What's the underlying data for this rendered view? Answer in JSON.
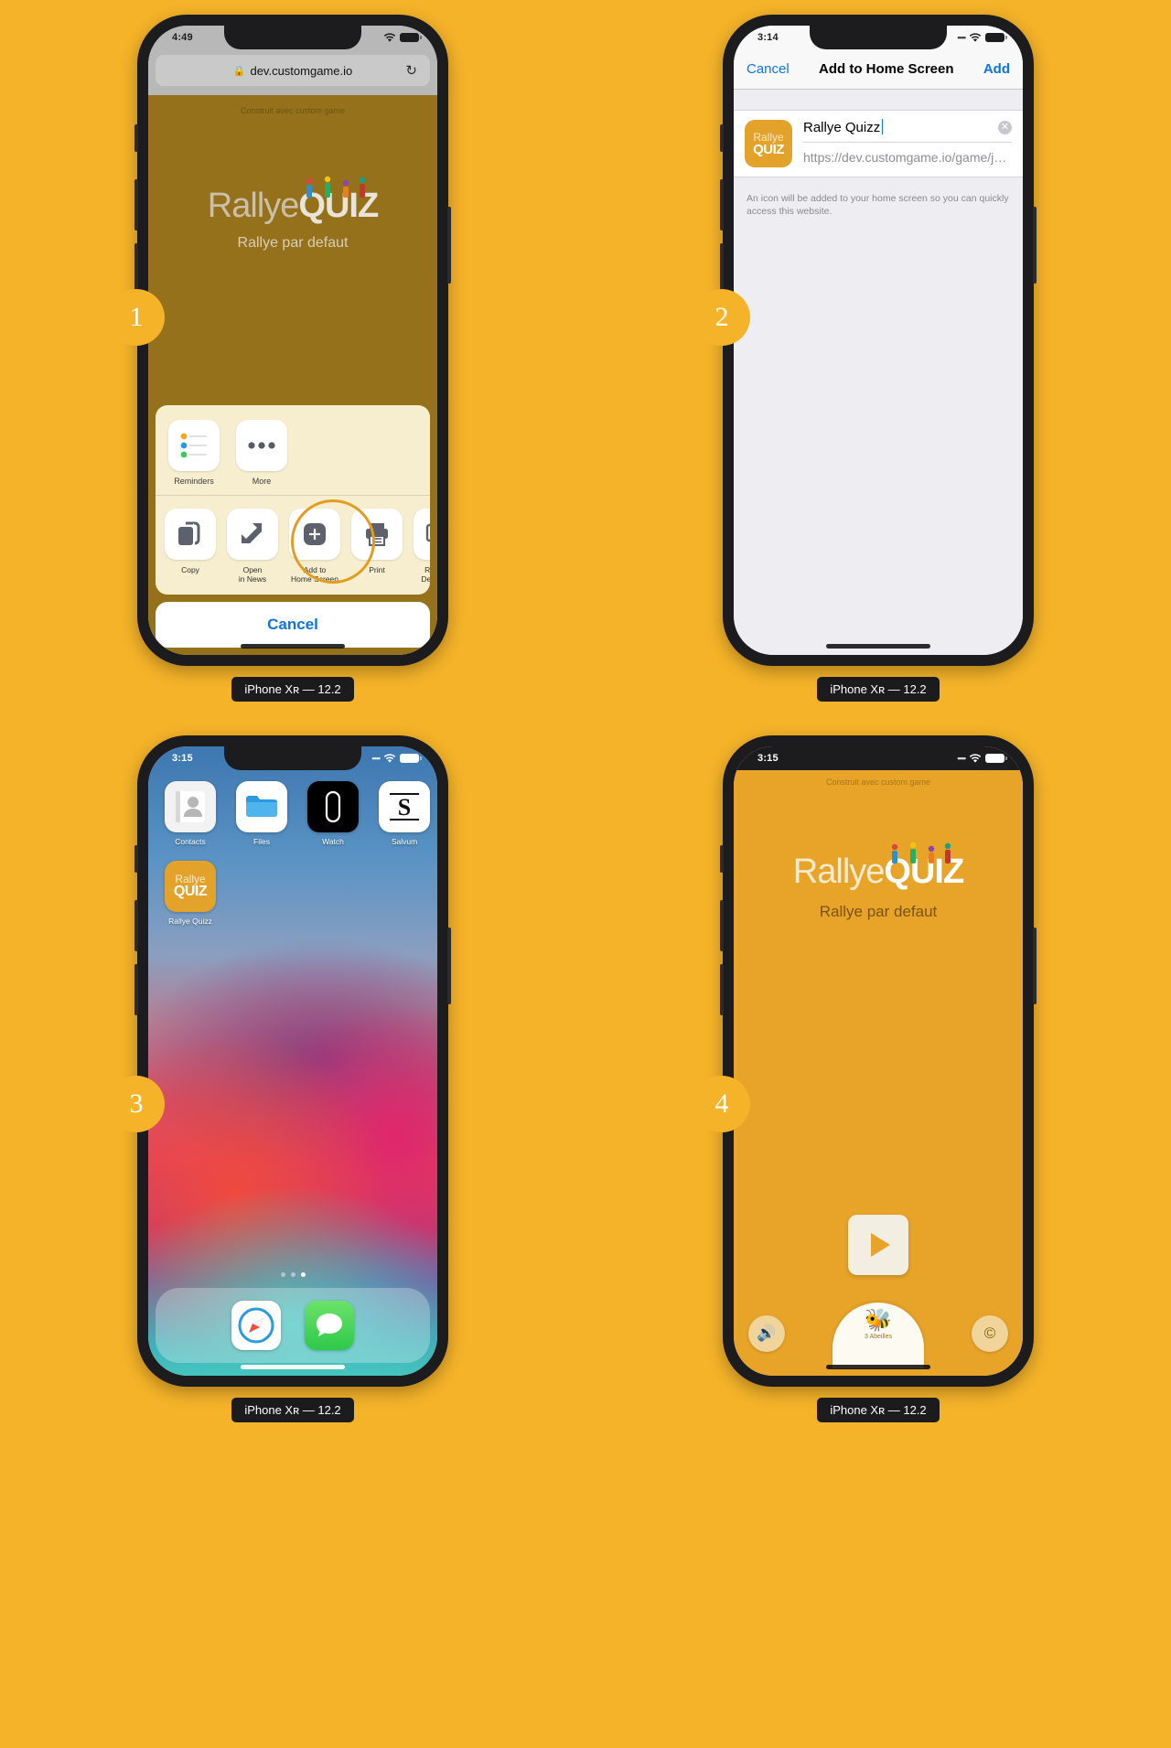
{
  "page": {
    "background_color": "#f5b329",
    "badge_color": "#f5b329",
    "caption_device": "iPhone X",
    "caption_device_sub": "R",
    "caption_version": " — 12.2"
  },
  "panels": [
    {
      "badge": "1",
      "caption": "iPhone Xʀ — 12.2",
      "status": {
        "time": "4:49",
        "dots": "",
        "wifi": "wifi-icon",
        "battery": "battery-icon"
      },
      "safari": {
        "url": "dev.customgame.io",
        "lock_icon": "lock-icon",
        "reload_icon": "reload-icon"
      },
      "page": {
        "built_with": "Construit avec custom game",
        "logo_part1": "Rallye",
        "logo_part2": "QUIZ",
        "subtitle": "Rallye par defaut"
      },
      "share_sheet": {
        "apps": [
          {
            "label": "Reminders",
            "icon": "reminders-icon"
          },
          {
            "label": "More",
            "icon": "more-icon"
          }
        ],
        "actions": [
          {
            "label": "Copy",
            "icon": "copy-icon",
            "highlighted": false
          },
          {
            "label": "Open\nin News",
            "icon": "news-icon",
            "highlighted": false
          },
          {
            "label": "Add to\nHome Screen",
            "icon": "add-to-home-screen-icon",
            "highlighted": true
          },
          {
            "label": "Print",
            "icon": "printer-icon",
            "highlighted": false
          },
          {
            "label": "Request\nDesktop S",
            "icon": "desktop-icon",
            "highlighted": false
          }
        ],
        "cancel_label": "Cancel",
        "highlight_color": "#e39c22"
      }
    },
    {
      "badge": "2",
      "caption": "iPhone Xʀ — 12.2",
      "status": {
        "time": "3:14"
      },
      "nav": {
        "cancel_label": "Cancel",
        "title": "Add to Home Screen",
        "add_label": "Add"
      },
      "form": {
        "icon_line1": "Rallye",
        "icon_line2": "QUIZ",
        "name_value": "Rallye Quizz",
        "clear_icon": "clear-icon",
        "url_value": "https://dev.customgame.io/game/jeu-...",
        "note": "An icon will be added to your home screen so you can quickly access this website."
      }
    },
    {
      "badge": "3",
      "caption": "iPhone Xʀ — 12.2",
      "status": {
        "time": "3:15"
      },
      "home": {
        "rows": [
          [
            {
              "label": "Contacts",
              "icon": "contacts-icon"
            },
            {
              "label": "Files",
              "icon": "files-icon"
            },
            {
              "label": "Watch",
              "icon": "watch-icon"
            },
            {
              "label": "Salvum",
              "icon": "salvum-icon"
            }
          ],
          [
            {
              "label": "Rallye Quizz",
              "icon": "rallye-quizz-icon"
            }
          ]
        ],
        "page_dots": 3,
        "active_dot": 3,
        "dock": [
          {
            "label": "Safari",
            "icon": "safari-icon"
          },
          {
            "label": "Messages",
            "icon": "messages-icon"
          }
        ]
      }
    },
    {
      "badge": "4",
      "caption": "iPhone Xʀ — 12.2",
      "status": {
        "time": "3:15"
      },
      "app": {
        "built_with": "Construit avec custom game",
        "logo_part1": "Rallye",
        "logo_part2": "QUIZ",
        "subtitle": "Rallye par defaut",
        "play_icon": "play-icon",
        "sound_icon": "speaker-icon",
        "copyright_icon": "copyright-icon",
        "bee_icon": "bee-icon",
        "bee_label": "3 Abeilles"
      }
    }
  ]
}
